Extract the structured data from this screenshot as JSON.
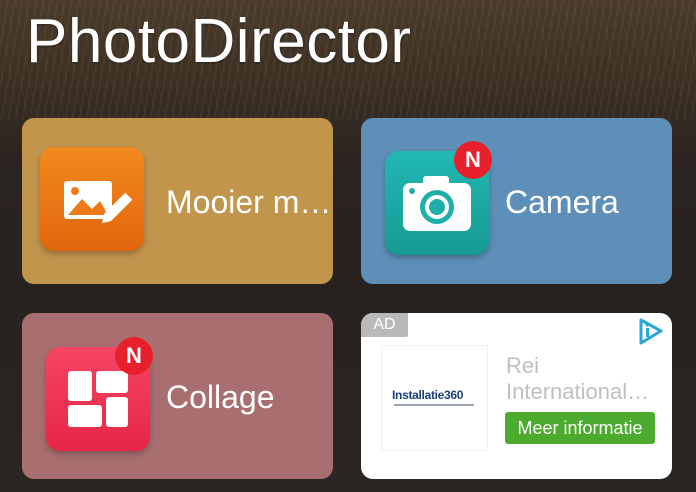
{
  "app": {
    "title": "PhotoDirector"
  },
  "tiles": [
    {
      "label": "Mooier m…",
      "icon": "photo-edit-icon",
      "color": "#c2954d",
      "icon_color": "#ee7a16",
      "badge": ""
    },
    {
      "label": "Camera",
      "icon": "camera-icon",
      "color": "#5e8fb8",
      "icon_color": "#1fafa9",
      "badge": "N"
    },
    {
      "label": "Collage",
      "icon": "collage-icon",
      "color": "#a96f70",
      "icon_color": "#f03655",
      "badge": "N"
    }
  ],
  "ad": {
    "label": "AD",
    "advertiser_logo_text": "Installatie360",
    "title": "Rei International…",
    "cta": "Meer informatie",
    "choices_icon": "ad-choices-icon",
    "cta_color": "#4caa2e"
  }
}
